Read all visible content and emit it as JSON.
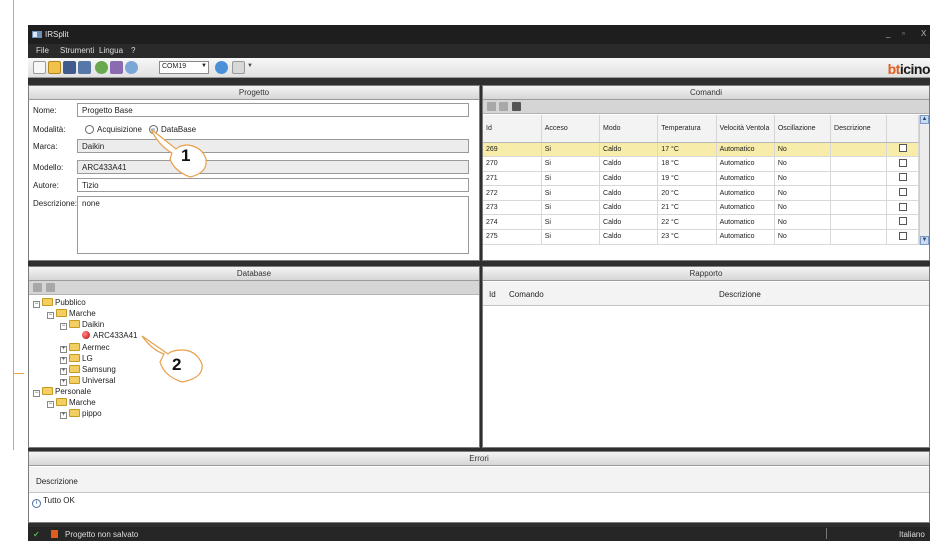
{
  "window": {
    "title": "IRSplit",
    "controls": [
      "_",
      "▫",
      "X"
    ]
  },
  "menu": [
    "File",
    "Strumenti",
    "Lingua",
    "?"
  ],
  "toolbar": {
    "com_port": "COM19",
    "brand_prefix": "bt",
    "brand_suffix": "icino",
    "accent": "#e25c1d"
  },
  "progetto": {
    "header": "Progetto",
    "nome_label": "Nome:",
    "nome_value": "Progetto Base",
    "modalita_label": "Modalità:",
    "modalita_opt1": "Acquisizione",
    "modalita_opt2": "DataBase",
    "marca_label": "Marca:",
    "marca_value": "Daikin",
    "modello_label": "Modello:",
    "modello_value": "ARC433A41",
    "autore_label": "Autore:",
    "autore_value": "Tizio",
    "descrizione_label": "Descrizione:",
    "descrizione_value": "none"
  },
  "comandi": {
    "header": "Comandi",
    "columns": [
      "Id",
      "Acceso",
      "Modo",
      "Temperatura",
      "Velocità Ventola",
      "Oscillazione",
      "Descrizione",
      ""
    ],
    "rows": [
      [
        "269",
        "Si",
        "Caldo",
        "17 °C",
        "Automatico",
        "No",
        ""
      ],
      [
        "270",
        "Si",
        "Caldo",
        "18 °C",
        "Automatico",
        "No",
        ""
      ],
      [
        "271",
        "Si",
        "Caldo",
        "19 °C",
        "Automatico",
        "No",
        ""
      ],
      [
        "272",
        "Si",
        "Caldo",
        "20 °C",
        "Automatico",
        "No",
        ""
      ],
      [
        "273",
        "Si",
        "Caldo",
        "21 °C",
        "Automatico",
        "No",
        ""
      ],
      [
        "274",
        "Si",
        "Caldo",
        "22 °C",
        "Automatico",
        "No",
        ""
      ],
      [
        "275",
        "Si",
        "Caldo",
        "23 °C",
        "Automatico",
        "No",
        ""
      ]
    ],
    "selected_row": 0
  },
  "database": {
    "header": "Database",
    "tree": {
      "pubblico": "Pubblico",
      "marche": "Marche",
      "daikin": "Daikin",
      "arc": "ARC433A41",
      "aermec": "Aermec",
      "lg": "LG",
      "samsung": "Samsung",
      "universal": "Universal",
      "personale": "Personale",
      "marche2": "Marche",
      "pippo": "pippo"
    }
  },
  "rapporto": {
    "header": "Rapporto",
    "col_id": "Id",
    "col_comando": "Comando",
    "col_descrizione": "Descrizione"
  },
  "errori": {
    "header": "Errori",
    "col_descrizione": "Descrizione",
    "message": "Tutto OK"
  },
  "status": {
    "text": "Progetto non salvato",
    "language": "Italiano"
  },
  "callouts": {
    "one": "1",
    "two": "2"
  }
}
